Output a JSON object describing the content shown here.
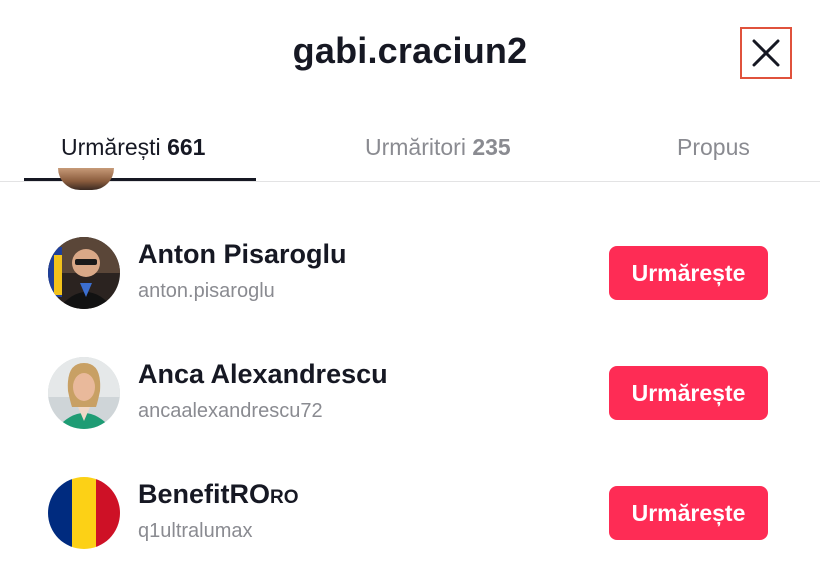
{
  "header": {
    "title": "gabi.craciun2",
    "close_icon": "close-icon"
  },
  "tabs": [
    {
      "label": "Urmărești",
      "count": "661",
      "active": true
    },
    {
      "label": "Urmăritori",
      "count": "235",
      "active": false
    },
    {
      "label": "Propus",
      "count": "",
      "active": false
    }
  ],
  "users": [
    {
      "name": "Anton Pisaroglu",
      "name_suffix": "",
      "username": "anton.pisaroglu",
      "button": "Urmărește"
    },
    {
      "name": "Anca Alexandrescu",
      "name_suffix": "",
      "username": "ancaalexandrescu72",
      "button": "Urmărește"
    },
    {
      "name": "BenefitRO",
      "name_suffix": "RO",
      "username": "q1ultralumax",
      "button": "Urmărește"
    }
  ],
  "colors": {
    "accent": "#fe2c55",
    "text_primary": "#161823",
    "text_secondary": "#8a8b91",
    "close_outline": "#e0523c"
  }
}
